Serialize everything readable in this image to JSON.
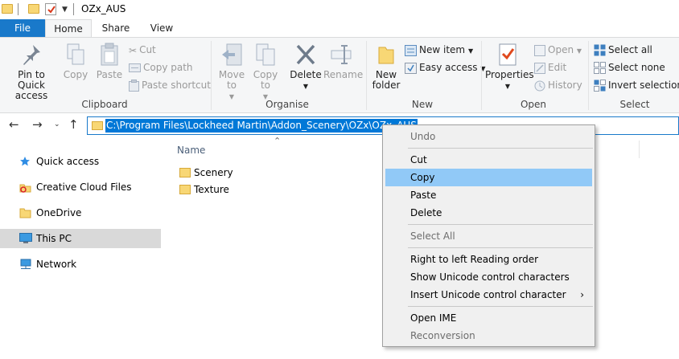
{
  "window": {
    "title": "OZx_AUS"
  },
  "tabs": [
    "File",
    "Home",
    "Share",
    "View"
  ],
  "ribbon": {
    "clipboard": {
      "label": "Clipboard",
      "pin": "Pin to Quick access",
      "copy": "Copy",
      "paste": "Paste",
      "cut": "Cut",
      "copy_path": "Copy path",
      "paste_shortcut": "Paste shortcut"
    },
    "organise": {
      "label": "Organise",
      "move_to": "Move to",
      "copy_to": "Copy to",
      "delete": "Delete",
      "rename": "Rename"
    },
    "new": {
      "label": "New",
      "new_folder": "New folder",
      "new_item": "New item",
      "easy_access": "Easy access"
    },
    "open": {
      "label": "Open",
      "properties": "Properties",
      "open": "Open",
      "edit": "Edit",
      "history": "History"
    },
    "select": {
      "label": "Select",
      "select_all": "Select all",
      "select_none": "Select none",
      "invert_selection": "Invert selection"
    }
  },
  "address": {
    "path": "C:\\Program Files\\Lockheed Martin\\Addon_Scenery\\OZx\\OZx_AUS"
  },
  "nav_pane": {
    "items": [
      {
        "label": "Quick access",
        "icon": "star-icon"
      },
      {
        "label": "Creative Cloud Files",
        "icon": "creative-cloud-icon"
      },
      {
        "label": "OneDrive",
        "icon": "folder-icon"
      },
      {
        "label": "This PC",
        "icon": "monitor-icon"
      },
      {
        "label": "Network",
        "icon": "network-icon"
      }
    ]
  },
  "file_list": {
    "column_name": "Name",
    "items": [
      "Scenery",
      "Texture"
    ]
  },
  "context_menu": {
    "undo": "Undo",
    "cut": "Cut",
    "copy": "Copy",
    "paste": "Paste",
    "delete": "Delete",
    "select_all": "Select All",
    "rtl": "Right to left Reading order",
    "show_unicode": "Show Unicode control characters",
    "insert_unicode": "Insert Unicode control character",
    "open_ime": "Open IME",
    "reconversion": "Reconversion"
  },
  "colors": {
    "accent": "#1979ca",
    "selection": "#0078d7",
    "menu_highlight": "#91c9f7",
    "folder": "#f8d775"
  }
}
